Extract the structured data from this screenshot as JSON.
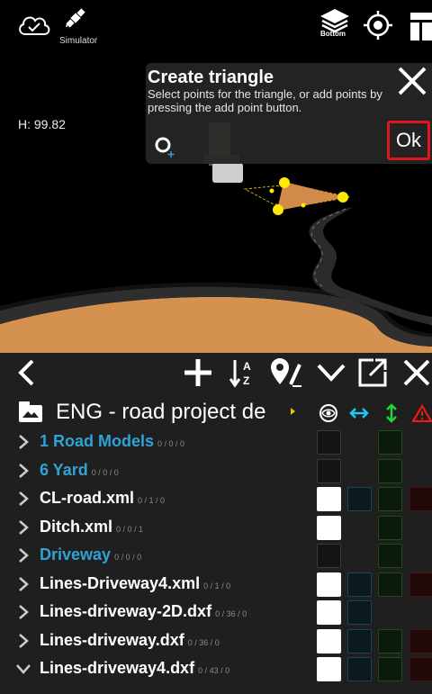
{
  "viewport": {
    "simulator_label": "Simulator",
    "layer_badge": "Bottom",
    "height_readout": "H: 99.82"
  },
  "icons": {
    "cloud": "cloud-check-icon",
    "satellite": "satellite-icon",
    "layers": "layers-icon",
    "target": "crosshair-target-icon",
    "panel": "panel-layout-icon"
  },
  "dialog": {
    "title": "Create triangle",
    "description": "Select points for the triangle, or add points by pressing the add point button.",
    "ok_label": "Ok"
  },
  "panel": {
    "project_name": "ENG - road project de",
    "columns": [
      "visibility-eye-icon",
      "horizontal-arrows-icon",
      "vertical-arrows-icon",
      "warning-icon"
    ],
    "items": [
      {
        "label": "1 Road Models",
        "counts": "0 / 0 / 0",
        "folder": true,
        "expanded": false,
        "visible": false,
        "cyan": false,
        "green": true,
        "red": false
      },
      {
        "label": "6 Yard",
        "counts": "0 / 0 / 0",
        "folder": true,
        "expanded": false,
        "visible": false,
        "cyan": false,
        "green": true,
        "red": false
      },
      {
        "label": "CL-road.xml",
        "counts": "0 / 1 / 0",
        "folder": false,
        "expanded": false,
        "visible": true,
        "cyan": true,
        "green": true,
        "red": true
      },
      {
        "label": "Ditch.xml",
        "counts": "0 / 0 / 1",
        "folder": false,
        "expanded": false,
        "visible": true,
        "cyan": false,
        "green": true,
        "red": false
      },
      {
        "label": "Driveway",
        "counts": "0 / 0 / 0",
        "folder": true,
        "expanded": false,
        "visible": false,
        "cyan": false,
        "green": true,
        "red": false
      },
      {
        "label": "Lines-Driveway4.xml",
        "counts": "0 / 1 / 0",
        "folder": false,
        "expanded": false,
        "visible": true,
        "cyan": true,
        "green": true,
        "red": true
      },
      {
        "label": "Lines-driveway-2D.dxf",
        "counts": "0 / 36 / 0",
        "folder": false,
        "expanded": false,
        "visible": true,
        "cyan": true,
        "green": false,
        "red": false
      },
      {
        "label": "Lines-driveway.dxf",
        "counts": "0 / 36 / 0",
        "folder": false,
        "expanded": false,
        "visible": true,
        "cyan": true,
        "green": true,
        "red": true
      },
      {
        "label": "Lines-driveway4.dxf",
        "counts": "0 / 43 / 0",
        "folder": false,
        "expanded": true,
        "visible": true,
        "cyan": true,
        "green": true,
        "red": true
      }
    ]
  }
}
